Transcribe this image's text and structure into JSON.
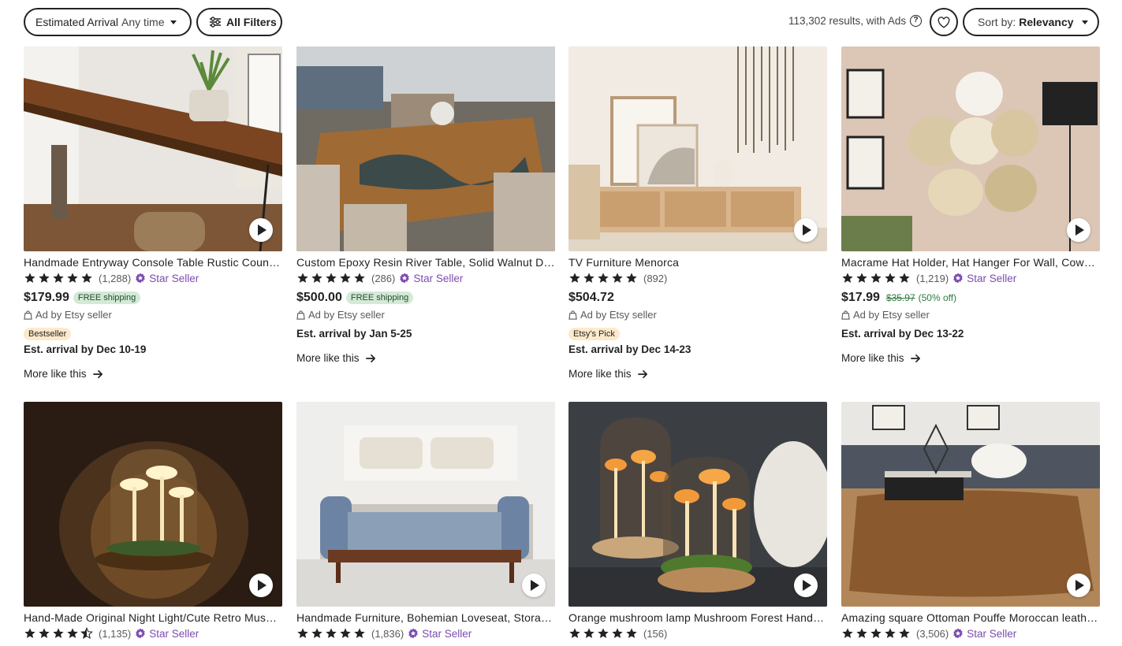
{
  "filters": {
    "arrival_label": "Estimated Arrival",
    "arrival_value": "Any time",
    "all_filters_label": "All Filters",
    "results_text": "113,302 results, with Ads",
    "sort_label": "Sort by:",
    "sort_value": "Relevancy"
  },
  "colors": {
    "star_seller": "#7b4cb0",
    "free_shipping_bg": "#d4e9d7",
    "tag_bg": "#fde9cb"
  },
  "cards": [
    {
      "title": "Handmade Entryway Console Table Rustic Country Farmhouse",
      "stars": 5,
      "reviews": "(1,288)",
      "star_seller": "Star Seller",
      "price": "$179.99",
      "shipping": "FREE shipping",
      "ad": "Ad by Etsy seller",
      "tag": "Bestseller",
      "eta": "Est. arrival by Dec 10-19",
      "more": "More like this",
      "icon": "play-icon"
    },
    {
      "title": "Custom Epoxy Resin River Table, Solid Walnut Dining Table",
      "stars": 5,
      "reviews": "(286)",
      "star_seller": "Star Seller",
      "price": "$500.00",
      "shipping": "FREE shipping",
      "ad": "Ad by Etsy seller",
      "eta": "Est. arrival by Jan 5-25",
      "more": "More like this"
    },
    {
      "title": "TV Furniture Menorca",
      "stars": 5,
      "reviews": "(892)",
      "price": "$504.72",
      "ad": "Ad by Etsy seller",
      "tag": "Etsy's Pick",
      "eta": "Est. arrival by Dec 14-23",
      "more": "More like this"
    },
    {
      "title": "Macrame Hat Holder, Hat Hanger For Wall, Cowboy Hat Rack",
      "stars": 5,
      "reviews": "(1,219)",
      "star_seller": "Star Seller",
      "price": "$17.99",
      "original_price": "$35.97",
      "discount": "(50% off)",
      "ad": "Ad by Etsy seller",
      "eta": "Est. arrival by Dec 13-22",
      "more": "More like this"
    },
    {
      "title": "Hand-Made Original Night Light/Cute Retro Mushroom Lamp",
      "stars": 4.5,
      "reviews": "(1,135)",
      "star_seller": "Star Seller"
    },
    {
      "title": "Handmade Furniture, Bohemian Loveseat, Storage Bench",
      "stars": 5,
      "reviews": "(1,836)",
      "star_seller": "Star Seller"
    },
    {
      "title": "Orange mushroom lamp Mushroom Forest Handmade Night Light",
      "stars": 5,
      "reviews": "(156)"
    },
    {
      "title": "Amazing square Ottoman Pouffe Moroccan leather Pouf",
      "stars": 5,
      "reviews": "(3,506)",
      "star_seller": "Star Seller"
    }
  ]
}
